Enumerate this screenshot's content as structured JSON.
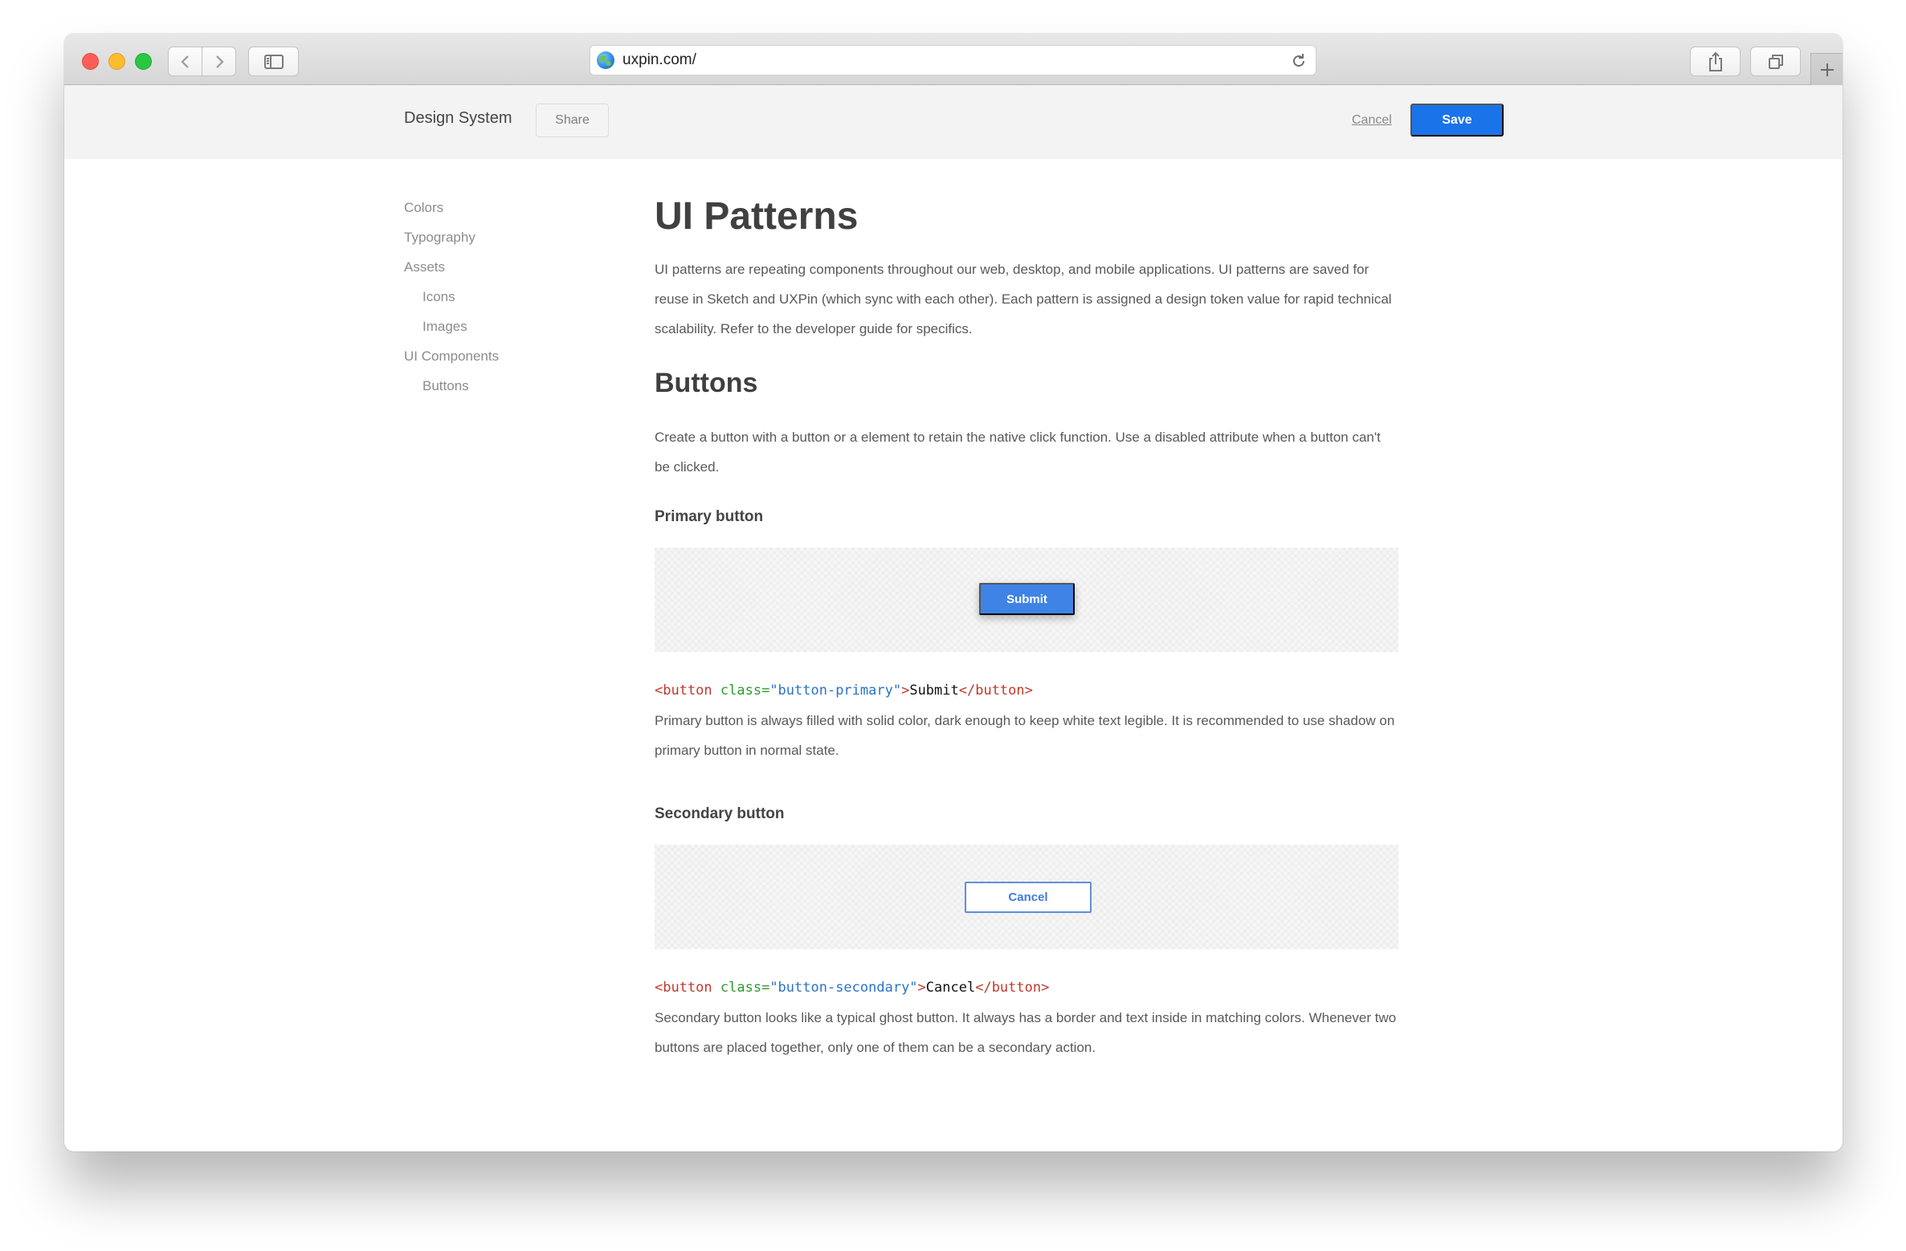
{
  "browser": {
    "url": "uxpin.com/"
  },
  "header": {
    "brand": "Design System",
    "share_label": "Share",
    "cancel_label": "Cancel",
    "save_label": "Save",
    "save_color": "#1a73e8"
  },
  "sidebar": {
    "items": [
      {
        "label": "Colors",
        "level": 0
      },
      {
        "label": "Typography",
        "level": 0
      },
      {
        "label": "Assets",
        "level": 0
      },
      {
        "label": "Icons",
        "level": 1
      },
      {
        "label": "Images",
        "level": 1
      },
      {
        "label": "UI Components",
        "level": 0
      },
      {
        "label": "Buttons",
        "level": 1
      }
    ]
  },
  "main": {
    "title": "UI Patterns",
    "intro": "UI patterns are repeating components throughout our web, desktop, and mobile applications. UI patterns are saved for reuse in Sketch and UXPin (which sync with each other). Each pattern is assigned a design token value for rapid technical scalability. Refer to the developer guide for specifics.",
    "buttons_heading": "Buttons",
    "buttons_text": "Create a button with a button or a element to retain the native click function. Use a disabled attribute when a button can't be clicked.",
    "primary": {
      "heading": "Primary button",
      "demo_label": "Submit",
      "code": {
        "open": "<button",
        "attr": " class=",
        "value": "\"button-primary\"",
        "close": ">",
        "text": "Submit",
        "end": "</button>"
      },
      "description": "Primary button is always filled with solid color, dark enough to keep white text legible. It is recommended to use shadow on primary button in normal state."
    },
    "secondary": {
      "heading": "Secondary button",
      "demo_label": "Cancel",
      "code": {
        "open": "<button",
        "attr": " class=",
        "value": "\"button-secondary\"",
        "close": ">",
        "text": "Cancel",
        "end": "</button>"
      },
      "description": "Secondary button looks like a typical ghost button. It always has a border and text inside in matching colors. Whenever two buttons are placed together, only one of them can be a secondary action."
    }
  }
}
